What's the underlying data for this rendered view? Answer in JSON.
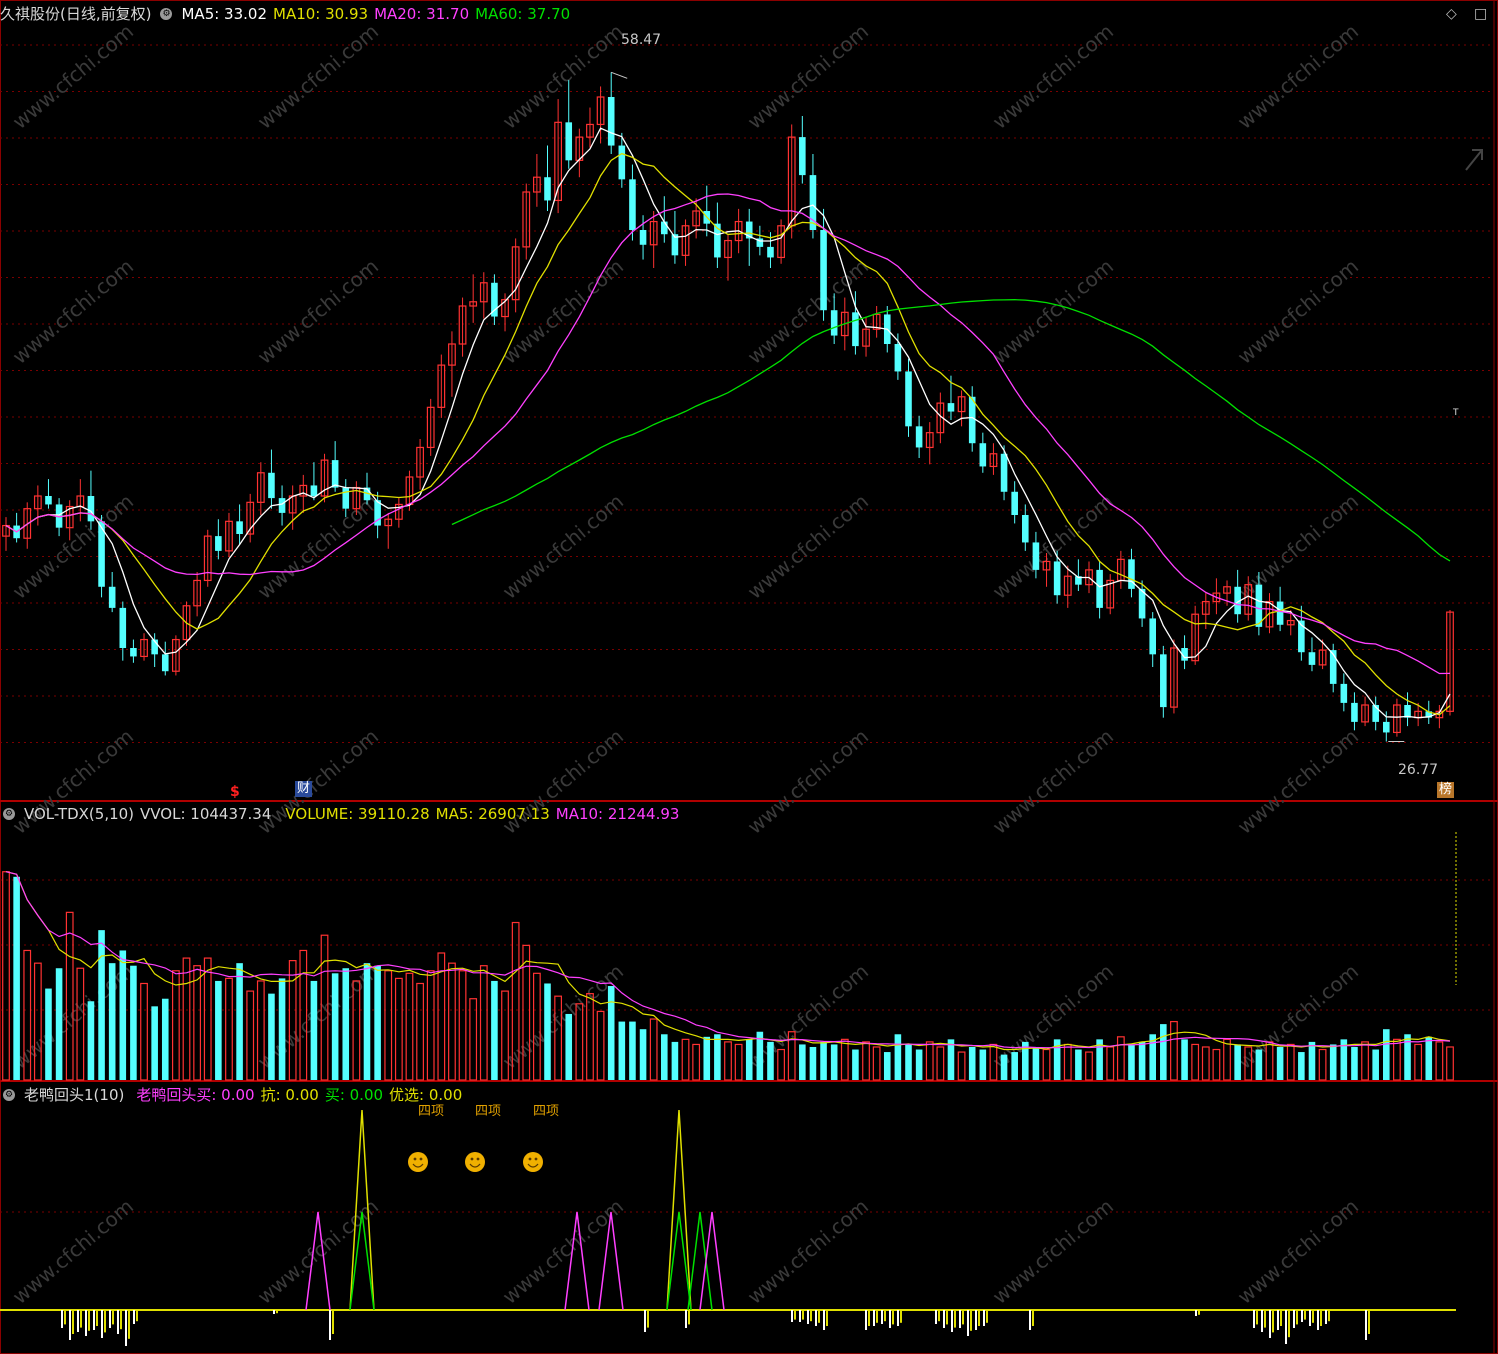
{
  "price_panel": {
    "title": "久祺股份(日线,前复权)",
    "ma5_label": "MA5: 33.02",
    "ma10_label": "MA10: 30.93",
    "ma20_label": "MA20: 31.70",
    "ma60_label": "MA60: 37.70",
    "high_label": "58.47",
    "low_label": "26.77",
    "marker_dollar": "$",
    "marker_cai": "财",
    "marker_bang": "榜",
    "marker_t": "T",
    "colors": {
      "ma5": "#ffffff",
      "ma10": "#e0e000",
      "ma20": "#ff40ff",
      "ma60": "#00e000",
      "up": "#ff3232",
      "down": "#54ffff"
    }
  },
  "volume_panel": {
    "title": "VOL-TDX(5,10)",
    "vvol_label": "VVOL: 104437.34",
    "volume_label": "VOLUME: 39110.28",
    "ma5_label": "MA5: 26907.13",
    "ma10_label": "MA10: 21244.93"
  },
  "indicator_panel": {
    "title": "老鸭回头1(10)",
    "buy_label": "老鸭回头买: 0.00",
    "kang_label": "抗: 0.00",
    "mai_label": "买: 0.00",
    "youxuan_label": "优选: 0.00",
    "smiley_label": "四项",
    "smiley_icon": "smiley-icon"
  },
  "window_controls": {
    "diamond": "◇",
    "square": "□"
  },
  "watermark": "www.cfchi.com",
  "chart_data": {
    "type": "candlestick",
    "price_ylim": [
      24,
      60
    ],
    "high": 58.47,
    "low": 26.77,
    "candles": [
      [
        36.5,
        37.4,
        35.8,
        37.0
      ],
      [
        37.0,
        37.6,
        36.2,
        36.4
      ],
      [
        36.4,
        38.1,
        35.9,
        37.8
      ],
      [
        37.8,
        38.9,
        37.0,
        38.4
      ],
      [
        38.4,
        39.2,
        37.8,
        38.0
      ],
      [
        38.0,
        38.3,
        36.5,
        36.9
      ],
      [
        36.9,
        38.2,
        36.3,
        37.9
      ],
      [
        37.9,
        39.2,
        37.2,
        38.4
      ],
      [
        38.4,
        39.6,
        36.8,
        37.2
      ],
      [
        37.2,
        37.5,
        33.6,
        34.1
      ],
      [
        34.1,
        34.8,
        32.9,
        33.1
      ],
      [
        33.1,
        33.4,
        30.6,
        31.2
      ],
      [
        31.2,
        31.6,
        30.5,
        30.8
      ],
      [
        30.8,
        31.9,
        30.6,
        31.6
      ],
      [
        31.6,
        31.9,
        30.3,
        30.9
      ],
      [
        30.9,
        31.5,
        29.9,
        30.1
      ],
      [
        30.1,
        31.8,
        29.9,
        31.6
      ],
      [
        31.6,
        33.4,
        31.3,
        33.2
      ],
      [
        33.2,
        34.8,
        32.7,
        34.4
      ],
      [
        34.4,
        36.8,
        34.1,
        36.5
      ],
      [
        36.5,
        37.3,
        35.4,
        35.8
      ],
      [
        35.8,
        37.6,
        35.5,
        37.2
      ],
      [
        37.2,
        38.0,
        36.1,
        36.6
      ],
      [
        36.6,
        38.5,
        36.2,
        38.1
      ],
      [
        38.1,
        40.0,
        37.5,
        39.5
      ],
      [
        39.5,
        40.6,
        37.8,
        38.3
      ],
      [
        38.3,
        38.9,
        37.0,
        37.6
      ],
      [
        37.6,
        38.9,
        36.8,
        38.4
      ],
      [
        38.4,
        39.4,
        37.6,
        38.9
      ],
      [
        38.9,
        40.0,
        38.2,
        38.4
      ],
      [
        38.4,
        40.4,
        38.1,
        40.1
      ],
      [
        40.1,
        41.0,
        38.6,
        38.8
      ],
      [
        38.8,
        39.2,
        37.4,
        37.8
      ],
      [
        37.8,
        39.1,
        37.5,
        38.8
      ],
      [
        38.8,
        39.5,
        38.0,
        38.2
      ],
      [
        38.2,
        38.6,
        36.4,
        37.0
      ],
      [
        37.0,
        37.6,
        35.9,
        37.3
      ],
      [
        37.3,
        38.3,
        36.9,
        38.0
      ],
      [
        38.0,
        39.6,
        37.7,
        39.3
      ],
      [
        39.3,
        41.1,
        38.7,
        40.7
      ],
      [
        40.7,
        43.0,
        40.3,
        42.6
      ],
      [
        42.6,
        45.1,
        42.1,
        44.6
      ],
      [
        44.6,
        46.2,
        43.1,
        45.6
      ],
      [
        45.6,
        47.8,
        45.0,
        47.4
      ],
      [
        47.4,
        48.9,
        46.6,
        47.6
      ],
      [
        47.6,
        49.0,
        46.8,
        48.5
      ],
      [
        48.5,
        48.9,
        46.5,
        46.9
      ],
      [
        46.9,
        48.0,
        46.2,
        47.7
      ],
      [
        47.7,
        50.6,
        47.1,
        50.2
      ],
      [
        50.2,
        53.2,
        49.6,
        52.8
      ],
      [
        52.8,
        54.6,
        52.1,
        53.5
      ],
      [
        53.5,
        55.0,
        51.9,
        52.4
      ],
      [
        52.4,
        57.2,
        51.8,
        56.1
      ],
      [
        56.1,
        58.1,
        53.9,
        54.3
      ],
      [
        54.3,
        55.8,
        53.5,
        55.4
      ],
      [
        55.4,
        56.8,
        54.9,
        56.0
      ],
      [
        56.0,
        57.8,
        55.1,
        57.3
      ],
      [
        57.3,
        58.47,
        54.6,
        55.0
      ],
      [
        55.0,
        55.6,
        53.0,
        53.4
      ],
      [
        53.4,
        54.1,
        50.5,
        51.0
      ],
      [
        51.0,
        51.7,
        49.6,
        50.3
      ],
      [
        50.3,
        51.9,
        49.2,
        51.4
      ],
      [
        51.4,
        52.6,
        50.4,
        50.8
      ],
      [
        50.8,
        51.9,
        49.4,
        49.8
      ],
      [
        49.8,
        51.5,
        49.3,
        51.2
      ],
      [
        51.2,
        52.5,
        50.6,
        51.9
      ],
      [
        51.9,
        53.1,
        50.7,
        51.3
      ],
      [
        51.3,
        52.3,
        49.2,
        49.7
      ],
      [
        49.7,
        50.8,
        48.6,
        50.5
      ],
      [
        50.5,
        52.0,
        49.9,
        51.4
      ],
      [
        51.4,
        52.0,
        49.3,
        50.6
      ],
      [
        50.6,
        51.2,
        49.8,
        50.2
      ],
      [
        50.2,
        50.9,
        49.2,
        49.7
      ],
      [
        49.7,
        51.5,
        49.4,
        51.2
      ],
      [
        51.2,
        56.0,
        50.6,
        55.4
      ],
      [
        55.4,
        56.4,
        53.2,
        53.6
      ],
      [
        53.6,
        54.6,
        50.6,
        51.0
      ],
      [
        51.0,
        52.0,
        46.7,
        47.2
      ],
      [
        47.2,
        48.0,
        45.6,
        46.0
      ],
      [
        46.0,
        47.8,
        45.3,
        47.1
      ],
      [
        47.1,
        48.1,
        45.1,
        45.5
      ],
      [
        45.5,
        46.9,
        45.0,
        46.3
      ],
      [
        46.3,
        47.4,
        45.9,
        47.0
      ],
      [
        47.0,
        47.4,
        45.2,
        45.6
      ],
      [
        45.6,
        46.1,
        43.9,
        44.3
      ],
      [
        44.3,
        44.9,
        41.2,
        41.7
      ],
      [
        41.7,
        42.2,
        40.2,
        40.7
      ],
      [
        40.7,
        41.9,
        39.9,
        41.4
      ],
      [
        41.4,
        43.3,
        40.9,
        42.8
      ],
      [
        42.8,
        44.1,
        42.0,
        42.4
      ],
      [
        42.4,
        43.4,
        41.7,
        43.1
      ],
      [
        43.1,
        43.6,
        40.5,
        40.9
      ],
      [
        40.9,
        41.4,
        39.5,
        39.8
      ],
      [
        39.8,
        40.9,
        39.4,
        40.4
      ],
      [
        40.4,
        40.8,
        38.2,
        38.6
      ],
      [
        38.6,
        39.1,
        37.1,
        37.5
      ],
      [
        37.5,
        38.0,
        35.8,
        36.2
      ],
      [
        36.2,
        36.7,
        34.5,
        34.9
      ],
      [
        34.9,
        35.7,
        34.1,
        35.3
      ],
      [
        35.3,
        35.8,
        33.3,
        33.7
      ],
      [
        33.7,
        35.1,
        33.1,
        34.6
      ],
      [
        34.6,
        35.4,
        33.9,
        34.2
      ],
      [
        34.2,
        35.3,
        33.8,
        34.9
      ],
      [
        34.9,
        35.3,
        32.6,
        33.1
      ],
      [
        33.1,
        34.7,
        32.8,
        34.4
      ],
      [
        34.4,
        35.8,
        34.0,
        35.4
      ],
      [
        35.4,
        35.9,
        33.6,
        34.0
      ],
      [
        34.0,
        34.4,
        32.2,
        32.6
      ],
      [
        32.6,
        32.9,
        30.3,
        30.9
      ],
      [
        30.9,
        31.3,
        27.9,
        28.4
      ],
      [
        28.4,
        31.6,
        28.1,
        31.2
      ],
      [
        31.2,
        31.8,
        30.2,
        30.6
      ],
      [
        30.6,
        33.2,
        30.4,
        32.8
      ],
      [
        32.8,
        33.8,
        32.1,
        33.4
      ],
      [
        33.4,
        34.5,
        32.8,
        33.8
      ],
      [
        33.8,
        34.4,
        33.2,
        34.1
      ],
      [
        34.1,
        34.9,
        32.4,
        32.8
      ],
      [
        32.8,
        34.6,
        32.5,
        34.2
      ],
      [
        34.2,
        34.8,
        31.8,
        32.2
      ],
      [
        32.2,
        33.8,
        31.9,
        33.4
      ],
      [
        33.4,
        34.1,
        32.0,
        32.3
      ],
      [
        32.3,
        33.0,
        31.8,
        32.5
      ],
      [
        32.5,
        33.2,
        30.6,
        31.0
      ],
      [
        31.0,
        31.7,
        30.1,
        30.4
      ],
      [
        30.4,
        31.6,
        30.2,
        31.1
      ],
      [
        31.1,
        31.4,
        29.1,
        29.5
      ],
      [
        29.5,
        30.0,
        28.2,
        28.6
      ],
      [
        28.6,
        29.1,
        27.3,
        27.7
      ],
      [
        27.7,
        28.9,
        27.5,
        28.5
      ],
      [
        28.5,
        28.9,
        27.3,
        27.7
      ],
      [
        27.7,
        28.2,
        26.77,
        27.2
      ],
      [
        27.2,
        28.8,
        27.0,
        28.5
      ],
      [
        28.5,
        29.1,
        27.5,
        27.9
      ],
      [
        27.9,
        28.6,
        27.5,
        28.2
      ],
      [
        28.2,
        28.7,
        27.6,
        27.9
      ],
      [
        27.9,
        28.5,
        27.4,
        28.2
      ],
      [
        28.2,
        33.0,
        28.0,
        32.9
      ]
    ],
    "ma60_start_index": 42,
    "volumes": [
      8.2,
      8.0,
      5.1,
      4.6,
      3.6,
      4.4,
      6.6,
      4.4,
      3.1,
      5.9,
      4.6,
      5.1,
      4.5,
      3.8,
      2.9,
      3.2,
      4.3,
      4.8,
      4.5,
      4.8,
      3.9,
      4.0,
      4.6,
      3.5,
      3.9,
      3.4,
      4.0,
      4.7,
      5.1,
      3.9,
      5.7,
      4.2,
      4.4,
      3.9,
      4.6,
      4.5,
      4.3,
      4.0,
      4.2,
      3.8,
      4.3,
      5.0,
      4.6,
      4.3,
      3.2,
      4.5,
      3.9,
      3.5,
      6.2,
      5.3,
      4.2,
      3.8,
      3.3,
      2.6,
      3.0,
      3.4,
      2.7,
      3.7,
      2.3,
      2.3,
      2.0,
      2.4,
      1.8,
      1.5,
      1.6,
      1.4,
      1.7,
      1.8,
      1.5,
      1.4,
      1.6,
      1.9,
      1.5,
      1.2,
      1.9,
      1.4,
      1.3,
      1.5,
      1.4,
      1.6,
      1.2,
      1.5,
      1.3,
      1.1,
      1.8,
      1.4,
      1.2,
      1.5,
      1.3,
      1.6,
      1.1,
      1.3,
      1.2,
      1.4,
      1.0,
      1.1,
      1.5,
      1.3,
      1.2,
      1.6,
      1.4,
      1.2,
      1.1,
      1.6,
      1.3,
      1.7,
      1.4,
      1.5,
      1.8,
      2.2,
      2.3,
      1.6,
      1.4,
      1.3,
      1.2,
      1.6,
      1.4,
      1.3,
      1.2,
      1.5,
      1.3,
      1.4,
      1.1,
      1.5,
      1.2,
      1.4,
      1.6,
      1.3,
      1.5,
      1.2,
      2.0,
      1.6,
      1.8,
      1.4,
      1.7,
      1.5,
      1.3,
      1.6,
      1.2,
      1.4,
      1.3,
      1.5,
      4.4,
      3.7
    ],
    "vol_ylim": [
      0,
      10
    ]
  }
}
